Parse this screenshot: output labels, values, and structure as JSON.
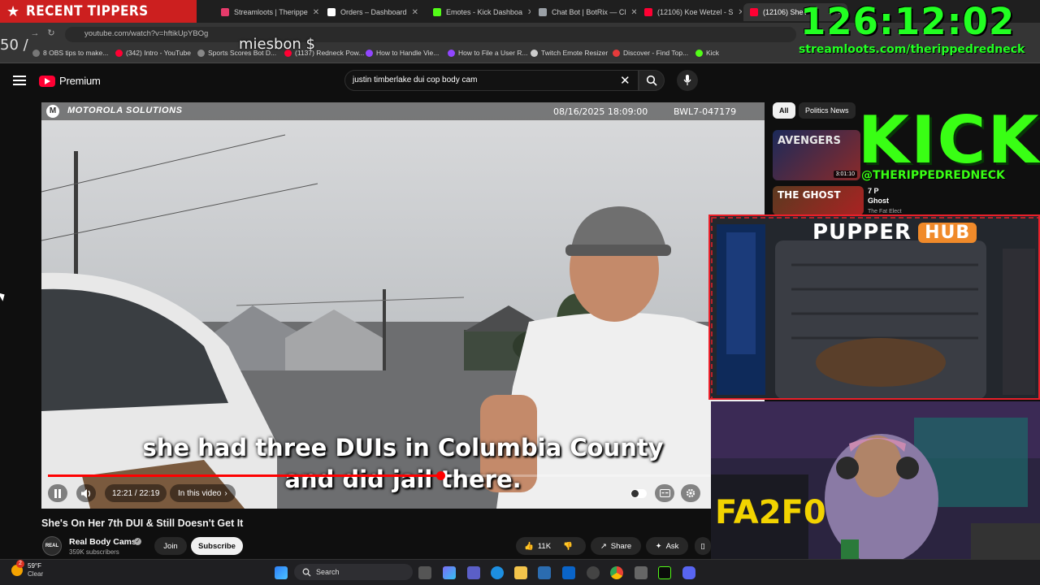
{
  "overlay": {
    "recent_tippers": "RECENT TIPPERS",
    "count": "50 /",
    "tipper_name": "miesbon $",
    "timer": "126:12:02",
    "stream_url": "streamloots.com/therippedredneck",
    "kick_word": "KICK",
    "kick_handle": "@THERIPPEDREDNECK",
    "pupper_word": "PUPPER",
    "hub_word": "HUB"
  },
  "browser": {
    "tabs": [
      {
        "label": "Streamloots | Therippe",
        "color": "#e63b6b"
      },
      {
        "label": "Orders – Dashboard",
        "color": "#ffffff"
      },
      {
        "label": "Emotes - Kick Dashboa",
        "color": "#53fc18"
      },
      {
        "label": "Chat Bot | BotRix — Cl",
        "color": "#9aa0a6"
      },
      {
        "label": "(12106) Koe Wetzel - S",
        "color": "#ff0033"
      },
      {
        "label": "(12106) She's",
        "color": "#ff0033"
      }
    ],
    "url": "youtube.com/watch?v=hftikUpYBOg",
    "bookmarks": [
      {
        "label": "8 OBS tips to make...",
        "color": "#777777"
      },
      {
        "label": "(342) Intro - YouTube",
        "color": "#ff0033"
      },
      {
        "label": "Sports Scores Bot D...",
        "color": "#888888"
      },
      {
        "label": "(1137) Redneck Pow...",
        "color": "#ff0033"
      },
      {
        "label": "How to Handle Vie...",
        "color": "#9146ff"
      },
      {
        "label": "How to File a User R...",
        "color": "#9146ff"
      },
      {
        "label": "Twitch Emote Resizer",
        "color": "#cccccc"
      },
      {
        "label": "Discover - Find Top...",
        "color": "#e63b3b"
      },
      {
        "label": "Kick",
        "color": "#53fc18"
      }
    ]
  },
  "youtube": {
    "logo_text": "Premium",
    "search_query": "justin timberlake dui cop body cam",
    "video": {
      "brand": "MOTOROLA SOLUTIONS",
      "timestamp": "08/16/2025 18:09:00",
      "camera_id": "BWL7-047179",
      "caption_line1": "she had three DUIs in Columbia County",
      "caption_line2": "and did jail there.",
      "time_display": "12:21 / 22:19",
      "chapter_label": "In this video",
      "progress": 0.553
    },
    "title": "She's On Her 7th DUI & Still Doesn't Get It",
    "channel": {
      "name": "Real Body Cams",
      "avatar_text": "REAL",
      "subscribers": "359K subscribers",
      "join_label": "Join",
      "subscribe_label": "Subscribe"
    },
    "actions": {
      "likes": "11K",
      "share_label": "Share",
      "ask_label": "Ask"
    },
    "chips": [
      "All",
      "Politics News"
    ],
    "recommendations": [
      {
        "duration": "3:01:10",
        "thumb_text": "AVENGERS"
      },
      {
        "title_line1": "7 P",
        "title_line2": "Ghost",
        "channel": "The Fat Elect",
        "thumb_text": "THE GHOST"
      }
    ]
  },
  "taskbar": {
    "temperature": "59°F",
    "condition": "Clear",
    "badge": "2",
    "search_label": "Search"
  }
}
